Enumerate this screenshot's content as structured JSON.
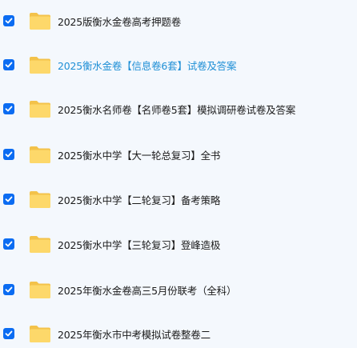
{
  "colors": {
    "checkbox": "#0b6cf2",
    "folder_back": "#f3c24a",
    "folder_front": "#fdd86a",
    "text": "#1b1b1b",
    "text_highlight": "#1f8fd6",
    "background": "#f4f8fd"
  },
  "items": [
    {
      "name": "2025版衡水金卷高考押题卷",
      "checked": true,
      "icon": "folder-icon"
    },
    {
      "name": "2025衡水金卷【信息卷6套】试卷及答案",
      "checked": true,
      "icon": "folder-icon",
      "highlighted": true
    },
    {
      "name": "2025衡水名师卷【名师卷5套】模拟调研卷试卷及答案",
      "checked": true,
      "icon": "folder-icon"
    },
    {
      "name": "2025衡水中学【大一轮总复习】全书",
      "checked": true,
      "icon": "folder-icon"
    },
    {
      "name": "2025衡水中学【二轮复习】备考策略",
      "checked": true,
      "icon": "folder-icon"
    },
    {
      "name": "2025衡水中学【三轮复习】登峰造极",
      "checked": true,
      "icon": "folder-icon"
    },
    {
      "name": "2025年衡水金卷高三5月份联考（全科）",
      "checked": true,
      "icon": "folder-icon"
    },
    {
      "name": "2025年衡水市中考模拟试卷整卷二",
      "checked": true,
      "icon": "folder-icon"
    }
  ]
}
